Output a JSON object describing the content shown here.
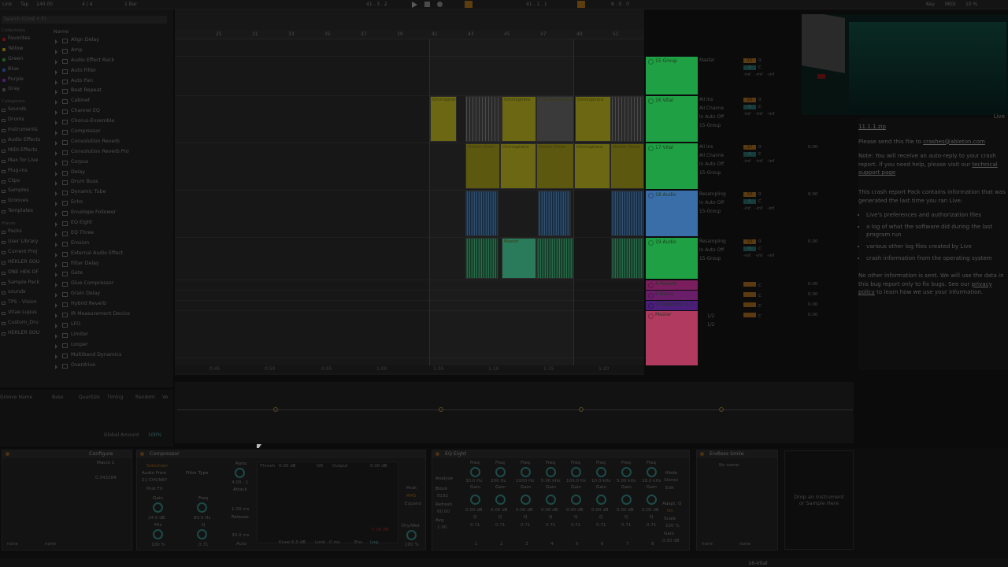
{
  "topbar": {
    "link": "Link",
    "tap": "Tap",
    "tempo": "140.00",
    "meter": "4 / 4",
    "quantize": "1 Bar",
    "pos1": "41 .  3 .  2",
    "pos2": "41 .  1 .  1",
    "pos3": "8 .  0 .  0",
    "key": "Key",
    "midi": "MIDI",
    "cpu": "10 %"
  },
  "browser": {
    "search_placeholder": "Search (Cmd + F)",
    "name_header": "Name",
    "collections_head": "Collections",
    "collections": [
      {
        "label": "Favorites",
        "color": "#6a1010"
      },
      {
        "label": "Yellow",
        "color": "#6a5a10"
      },
      {
        "label": "Green",
        "color": "#1e5a1e"
      },
      {
        "label": "Blue",
        "color": "#1e3a6a"
      },
      {
        "label": "Purple",
        "color": "#4a1e6a"
      },
      {
        "label": "Gray",
        "color": "#3a3a3a"
      }
    ],
    "categories_head": "Categories",
    "categories": [
      "Sounds",
      "Drums",
      "Instruments",
      "Audio Effects",
      "MIDI Effects",
      "Max for Live",
      "Plug-ins",
      "Clips",
      "Samples",
      "Grooves",
      "Templates"
    ],
    "places_head": "Places",
    "places": [
      "Packs",
      "User Library",
      "Current Proj",
      "HEKLER SOU",
      "ONE HEK OF",
      "Sample Pack",
      "sounds",
      "TPS - Vision",
      "Vitae Lupus",
      "Custom_Dru",
      "HEKLER SOU"
    ],
    "devices": [
      "Align Delay",
      "Amp",
      "Audio Effect Rack",
      "Auto Filter",
      "Auto Pan",
      "Beat Repeat",
      "Cabinet",
      "Channel EQ",
      "Chorus-Ensemble",
      "Compressor",
      "Convolution Reverb",
      "Convolution Reverb Pro",
      "Corpus",
      "Delay",
      "Drum Buss",
      "Dynamic Tube",
      "Echo",
      "Envelope Follower",
      "EQ Eight",
      "EQ Three",
      "Erosion",
      "External Audio Effect",
      "Filter Delay",
      "Gate",
      "Glue Compressor",
      "Grain Delay",
      "Hybrid Reverb",
      "IR Measurement Device",
      "LFO",
      "Limiter",
      "Looper",
      "Multiband Dynamics",
      "Overdrive"
    ]
  },
  "groove": {
    "groove_name": "Groove Name",
    "base": "Base",
    "quantize": "Quantize",
    "timing": "Timing",
    "random": "Random",
    "vel": "Ve",
    "global_amount": "Global Amount",
    "global_value": "100%"
  },
  "arrangement": {
    "ruler": [
      "25",
      "31",
      "33",
      "35",
      "37",
      "39",
      "41",
      "43",
      "45",
      "47",
      "49",
      "51"
    ],
    "times": [
      "0:45",
      "0:50",
      "0:55",
      "1:00",
      "1:05",
      "1:10",
      "1:15",
      "1:20"
    ],
    "clip_labels": {
      "omni": "Omnisphere",
      "omni_short": "Omnis Omni",
      "deactivated": "Clip Deactivated",
      "master": "Master"
    }
  },
  "tracks": [
    {
      "name": "15 Group",
      "color": "#1fa044",
      "io": [
        "Master"
      ],
      "mix": "15"
    },
    {
      "name": "16 Vital",
      "color": "#1fa044",
      "io": [
        "All Ins",
        "All Channe",
        "In  Auto  Off",
        "15-Group"
      ],
      "mix": "16"
    },
    {
      "name": "17 Vital",
      "color": "#1fa044",
      "io": [
        "All Ins",
        "All Channe",
        "In  Auto  Off",
        "15-Group"
      ],
      "mix": "17"
    },
    {
      "name": "18 Audio",
      "color": "#3a6ea8",
      "io": [
        "Resampling",
        "In  Auto  Off",
        "15-Group"
      ],
      "mix": "18"
    },
    {
      "name": "19 Audio",
      "color": "#1fa044",
      "io": [
        "Resampling",
        "In  Auto  Off",
        "15-Group"
      ],
      "mix": "19"
    }
  ],
  "returns": [
    {
      "name": "A Reverb",
      "color": "#7a1e5e"
    },
    {
      "name": "B Delay",
      "color": "#6a1e6a"
    },
    {
      "name": "C Resonator 1.2",
      "color": "#4a1e7a"
    },
    {
      "name": "Master",
      "color": "#b03a60"
    }
  ],
  "mixer_common": {
    "vol": "0",
    "c": "C",
    "inf": "-inf",
    "db": "0.00",
    "half": "1/2"
  },
  "help": {
    "filename": "11.1.1.zip",
    "p1_pre": "Please send this file to ",
    "email": "crashes@ableton.com",
    "p2_pre": "Note: You will receive an auto-reply to your crash report. If you need help, please visit our ",
    "support_link": "technical support page",
    "p3": "This crash report Pack contains information that was generated the last time you ran Live:",
    "bullets": [
      "Live's preferences and authorization files",
      "a log of what the software did during the last program run",
      "various other log files created by Live",
      "crash information from the operating system"
    ],
    "p4_pre": "No other information is sent. We will use the data in this bug report only to fix bugs. See our ",
    "privacy_link": "privacy policy",
    "p4_post": " to learn how we use your information.",
    "live_label": "Live"
  },
  "devices": {
    "configure": "Configure",
    "macro": "Macro 1",
    "macro_value": "0.343284",
    "compressor": {
      "title": "Compressor",
      "sidechain": "Sidechain",
      "audio_from": "Audio From",
      "source": "21-CHUNKY",
      "post_fx": "Post FX",
      "filter_type": "Filter Type",
      "freq": "Freq",
      "gain": "Gain",
      "mix": "Mix",
      "gain_val": "24.0 dB",
      "mix_val": "100 %",
      "freq_val": "80.0 Hz",
      "q": "Q",
      "q_val": "0.71",
      "ratio": "Ratio",
      "ratio_val": "4.00 : 1",
      "attack": "Attack",
      "attack_val": "1.00 ms",
      "release": "Release",
      "release_val": "30.0 ms",
      "auto": "Auto",
      "thresh": "Thresh",
      "thresh_val": "0.00 dB",
      "gr": "GR",
      "output": "Output",
      "output_val": "0.00 dB",
      "knee": "Knee",
      "knee_val": "6.0 dB",
      "look": "Look",
      "look_val": "0 ms",
      "env": "Env",
      "env_val": "Log",
      "peak": "Peak",
      "rms": "RMS",
      "expand": "Expand",
      "drywet": "Dry/Wet",
      "drywet_val": "100 %",
      "db_val": "-7.00 dB"
    },
    "eq": {
      "title": "EQ Eight",
      "analyze": "Analyze",
      "block": "Block",
      "block_val": "8192",
      "refresh": "Refresh",
      "refresh_val": "60.00",
      "avg": "Avg",
      "avg_val": "1.00",
      "bands": [
        {
          "freq": "30.0 Hz",
          "gain": "0.00 dB",
          "q": "0.71",
          "num": "1"
        },
        {
          "freq": "200 Hz",
          "gain": "0.00 dB",
          "q": "0.71",
          "num": "2"
        },
        {
          "freq": "1000 Hz",
          "gain": "0.00 dB",
          "q": "0.71",
          "num": "3"
        },
        {
          "freq": "5.00 kHz",
          "gain": "0.00 dB",
          "q": "0.71",
          "num": "4"
        },
        {
          "freq": "100.0 Hz",
          "gain": "0.00 dB",
          "q": "0.71",
          "num": "5"
        },
        {
          "freq": "10.0 kHz",
          "gain": "0.00 dB",
          "q": "0.71",
          "num": "6"
        },
        {
          "freq": "5.00 kHz",
          "gain": "0.00 dB",
          "q": "0.71",
          "num": "7"
        },
        {
          "freq": "18.0 kHz",
          "gain": "0.00 dB",
          "q": "0.71",
          "num": "8"
        }
      ],
      "freq": "Freq",
      "gain": "Gain",
      "q": "Q",
      "mode": "Mode",
      "stereo": "Stereo",
      "edit": "Edit",
      "adapt": "Adapt. Q",
      "on": "On",
      "scale": "Scale",
      "scale_val": "100 %",
      "gain_out": "Gain",
      "gain_out_val": "0.00 dB"
    },
    "smile": {
      "title": "Endless Smile",
      "preset": "No name"
    },
    "drop_text": "Drop an Instrument or Sample Here",
    "none": "none"
  },
  "status": {
    "track": "16-Vital"
  }
}
